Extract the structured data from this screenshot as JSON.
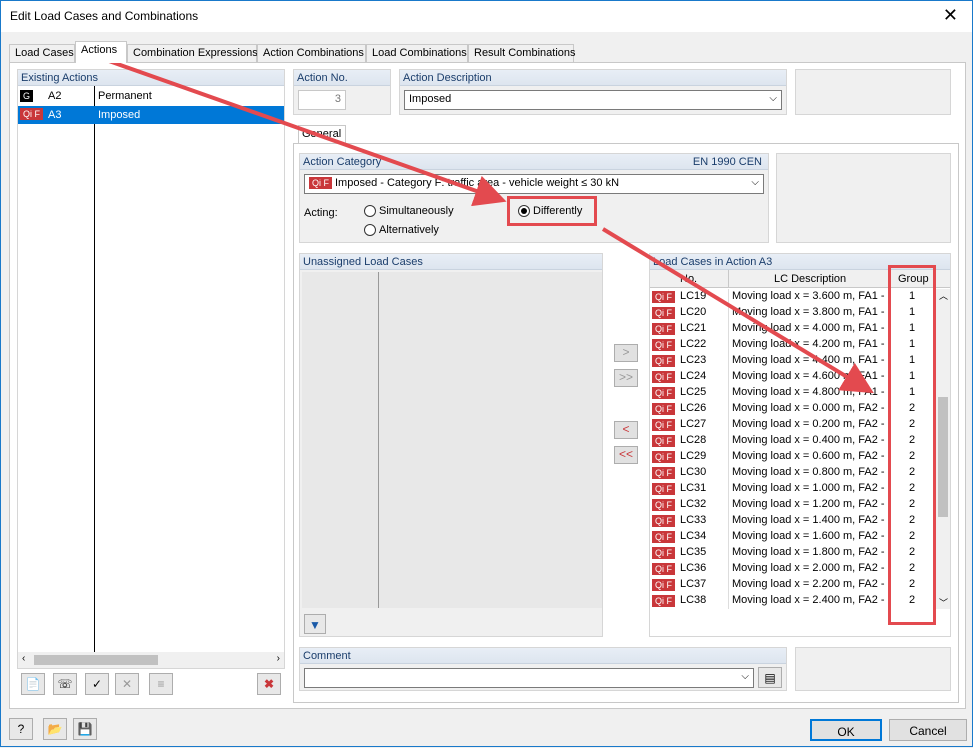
{
  "window": {
    "title": "Edit Load Cases and Combinations"
  },
  "tabs": [
    {
      "label": "Load Cases"
    },
    {
      "label": "Actions"
    },
    {
      "label": "Combination Expressions"
    },
    {
      "label": "Action Combinations"
    },
    {
      "label": "Load Combinations"
    },
    {
      "label": "Result Combinations"
    }
  ],
  "existing_actions": {
    "header": "Existing Actions",
    "rows": [
      {
        "badge": "G",
        "id": "A2",
        "name": "Permanent"
      },
      {
        "badge": "Qi F",
        "id": "A3",
        "name": "Imposed"
      }
    ]
  },
  "action_no": {
    "label": "Action No.",
    "value": "3"
  },
  "action_description": {
    "label": "Action Description",
    "value": "Imposed"
  },
  "subtab": {
    "label": "General"
  },
  "action_category": {
    "label": "Action Category",
    "standard": "EN 1990 CEN",
    "badge": "Qi F",
    "value": "Imposed - Category F: traffic area - vehicle weight ≤ 30 kN"
  },
  "acting": {
    "label": "Acting:",
    "simultaneously": "Simultaneously",
    "alternatively": "Alternatively",
    "differently": "Differently"
  },
  "unassigned": {
    "header": "Unassigned Load Cases"
  },
  "assigned": {
    "header": "Load Cases in Action A3",
    "col_no": "No.",
    "col_desc": "LC Description",
    "col_group": "Group",
    "badge": "Qi F",
    "rows": [
      {
        "no": "LC19",
        "desc": "Moving load x = 3.600 m, FA1 -",
        "group": "1"
      },
      {
        "no": "LC20",
        "desc": "Moving load x = 3.800 m, FA1 -",
        "group": "1"
      },
      {
        "no": "LC21",
        "desc": "Moving load x = 4.000 m, FA1 -",
        "group": "1"
      },
      {
        "no": "LC22",
        "desc": "Moving load x = 4.200 m, FA1 -",
        "group": "1"
      },
      {
        "no": "LC23",
        "desc": "Moving load x = 4.400 m, FA1 -",
        "group": "1"
      },
      {
        "no": "LC24",
        "desc": "Moving load x = 4.600 m, FA1 -",
        "group": "1"
      },
      {
        "no": "LC25",
        "desc": "Moving load x = 4.800 m, FA1 -",
        "group": "1"
      },
      {
        "no": "LC26",
        "desc": "Moving load x = 0.000 m, FA2 -",
        "group": "2"
      },
      {
        "no": "LC27",
        "desc": "Moving load x = 0.200 m, FA2 -",
        "group": "2"
      },
      {
        "no": "LC28",
        "desc": "Moving load x = 0.400 m, FA2 -",
        "group": "2"
      },
      {
        "no": "LC29",
        "desc": "Moving load x = 0.600 m, FA2 -",
        "group": "2"
      },
      {
        "no": "LC30",
        "desc": "Moving load x = 0.800 m, FA2 -",
        "group": "2"
      },
      {
        "no": "LC31",
        "desc": "Moving load x = 1.000 m, FA2 -",
        "group": "2"
      },
      {
        "no": "LC32",
        "desc": "Moving load x = 1.200 m, FA2 -",
        "group": "2"
      },
      {
        "no": "LC33",
        "desc": "Moving load x = 1.400 m, FA2 -",
        "group": "2"
      },
      {
        "no": "LC34",
        "desc": "Moving load x = 1.600 m, FA2 -",
        "group": "2"
      },
      {
        "no": "LC35",
        "desc": "Moving load x = 1.800 m, FA2 -",
        "group": "2"
      },
      {
        "no": "LC36",
        "desc": "Moving load x = 2.000 m, FA2 -",
        "group": "2"
      },
      {
        "no": "LC37",
        "desc": "Moving load x = 2.200 m, FA2 -",
        "group": "2"
      },
      {
        "no": "LC38",
        "desc": "Moving load x = 2.400 m, FA2 -",
        "group": "2"
      }
    ]
  },
  "transfer": {
    "add": ">",
    "add_all": ">>",
    "remove": "<",
    "remove_all": "<<"
  },
  "comment": {
    "label": "Comment",
    "value": ""
  },
  "footer": {
    "ok": "OK",
    "cancel": "Cancel"
  },
  "colors": {
    "accent": "#0078d7",
    "annotation": "#e34a4f",
    "badge": "#c9373a"
  }
}
